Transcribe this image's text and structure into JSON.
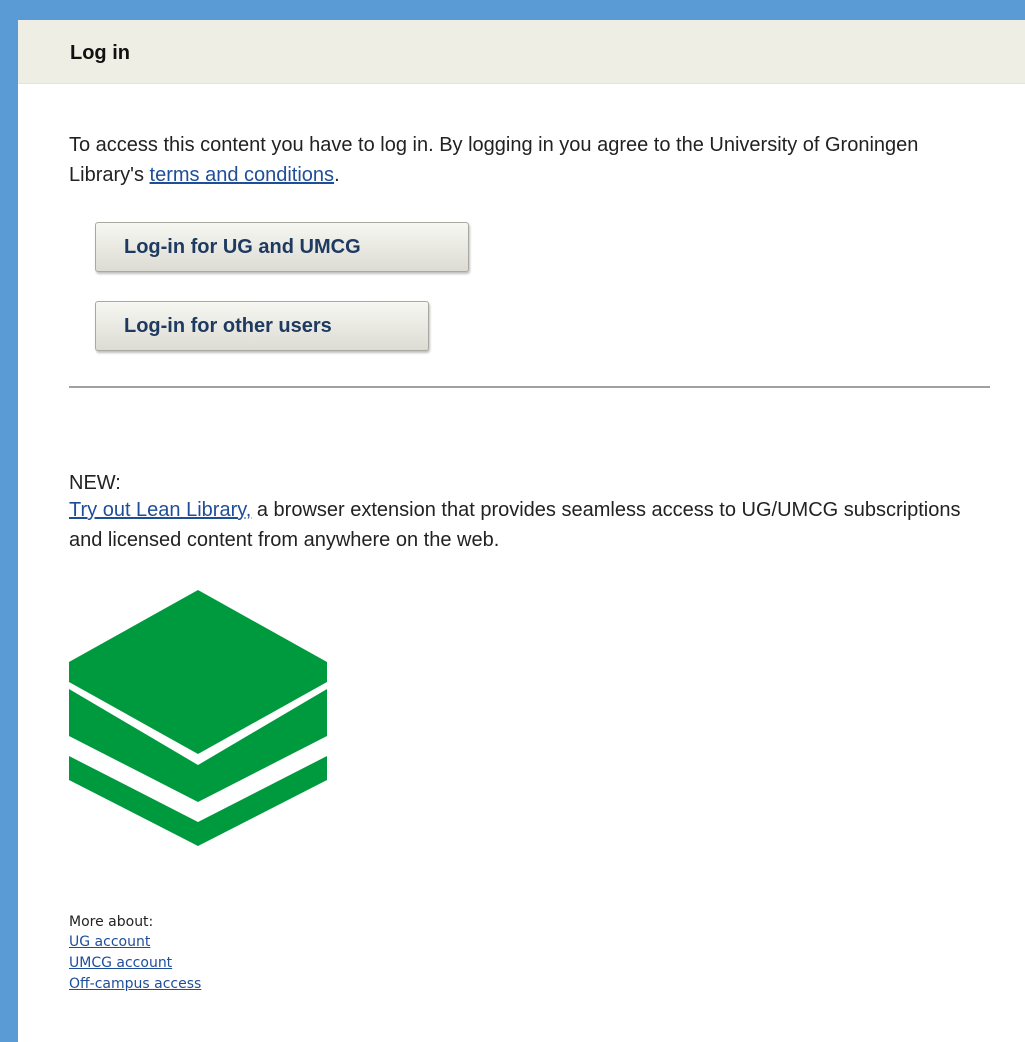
{
  "header": {
    "title": "Log in"
  },
  "intro": {
    "text": "To access this content you have to log in. By logging in you agree to the University of Groningen Library's ",
    "link_text": "terms and conditions",
    "suffix": "."
  },
  "buttons": {
    "ug_label": "Log-in for UG and UMCG",
    "other_label": "Log-in for other users"
  },
  "promo": {
    "label": "NEW:",
    "link_text": "Try out Lean Library,",
    "text": " a browser extension that provides seamless access to UG/UMCG subscriptions and licensed content from anywhere on the web."
  },
  "logo": {
    "icon": "lean-library-logo-icon",
    "color": "#009a3e"
  },
  "more": {
    "label": "More about:",
    "links": [
      "UG account",
      "UMCG account",
      "Off-campus access"
    ]
  },
  "colors": {
    "frame": "#5b9bd5",
    "header_bg": "#eeeee4",
    "link": "#1f4e99",
    "button_text": "#1f3a60"
  }
}
